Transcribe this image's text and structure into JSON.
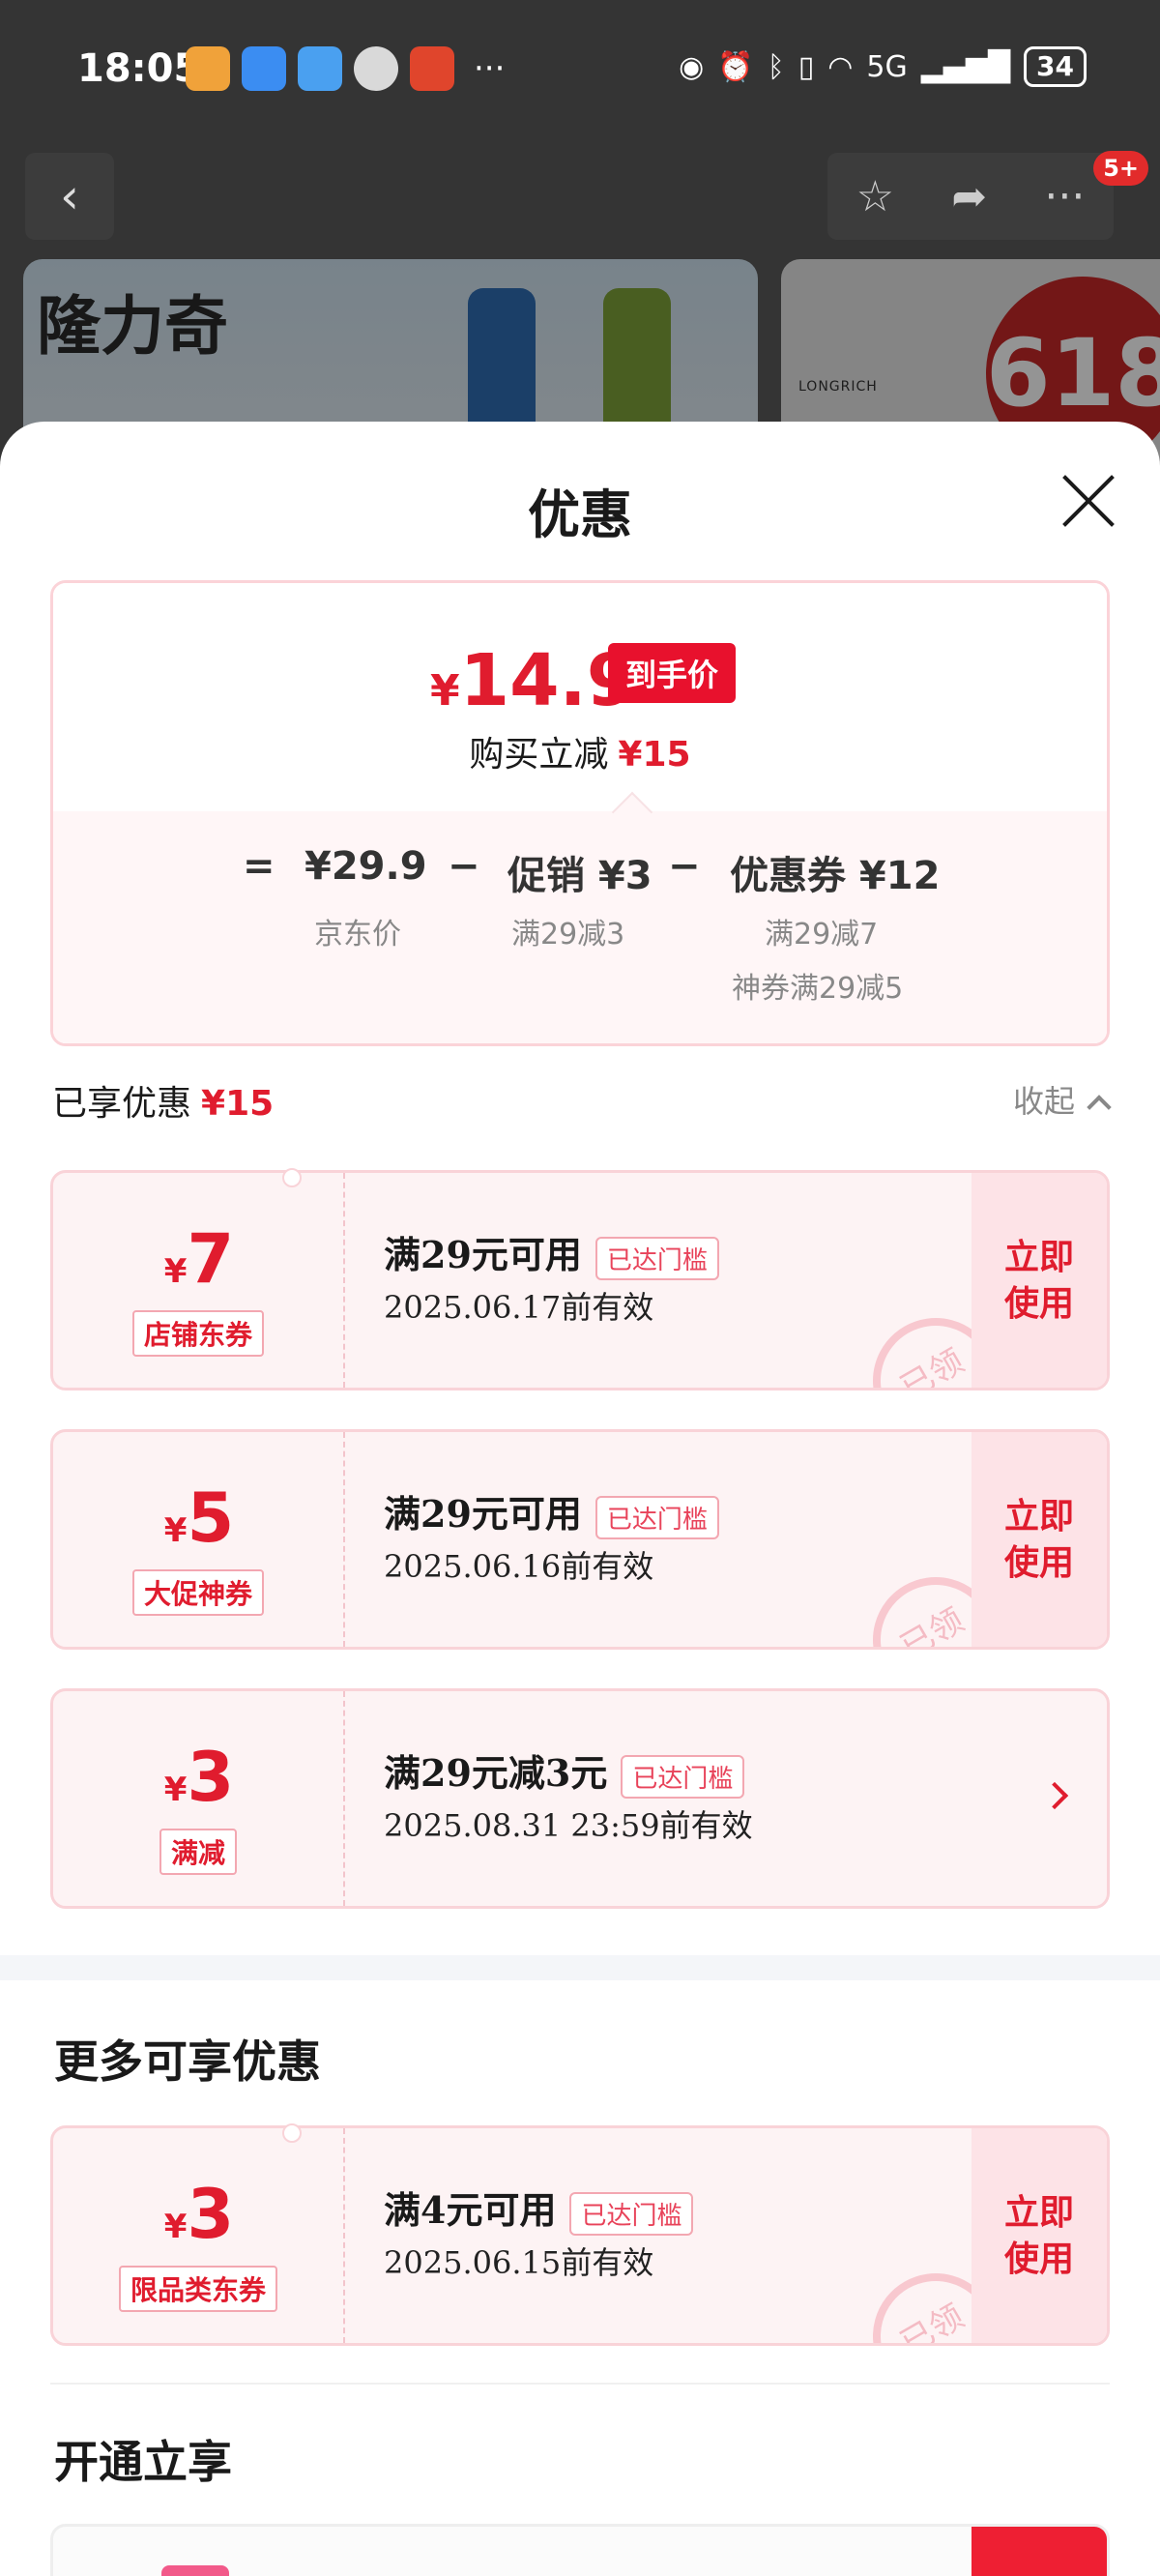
{
  "status_bar": {
    "time": "18:05",
    "network": "5G",
    "battery": "34",
    "more": "···"
  },
  "nav": {
    "badge": "5+"
  },
  "banner": {
    "brand": "隆力奇",
    "logo_text": "LONGRICH",
    "promo": "618"
  },
  "sheet": {
    "title": "优惠"
  },
  "summary": {
    "currency": "¥",
    "final_price": "14.9",
    "final_tag": "到手价",
    "instant_cut_label": "购买立减",
    "instant_cut_value": "¥15",
    "formula": {
      "eq": "=",
      "base": "¥29.9",
      "minus1": "−",
      "promo": "促销 ¥3",
      "minus2": "−",
      "coupon": "优惠券 ¥12"
    },
    "labels": {
      "base": "京东价",
      "promo": "满29减3",
      "coupon_line1": "满29减7",
      "coupon_line2": "神券满29减5"
    }
  },
  "enjoyed": {
    "label": "已享优惠",
    "value": "¥15",
    "collapse": "收起"
  },
  "coupons": [
    {
      "cur": "¥",
      "amount": "7",
      "type": "店铺东券",
      "cond": "满29元可用",
      "tag": "已达门槛",
      "date": "2025.06.17前有效",
      "use1": "立即",
      "use2": "使用",
      "stamp": "已领"
    },
    {
      "cur": "¥",
      "amount": "5",
      "type": "大促神券",
      "cond": "满29元可用",
      "tag": "已达门槛",
      "date": "2025.06.16前有效",
      "use1": "立即",
      "use2": "使用",
      "stamp": "已领"
    },
    {
      "cur": "¥",
      "amount": "3",
      "type": "满减",
      "cond": "满29元减3元",
      "tag": "已达门槛",
      "date": "2025.08.31 23:59前有效"
    }
  ],
  "more": {
    "title": "更多可享优惠",
    "coupon": {
      "cur": "¥",
      "amount": "3",
      "type": "限品类东券",
      "cond": "满4元可用",
      "tag": "已达门槛",
      "date": "2025.06.15前有效",
      "use1": "立即",
      "use2": "使用",
      "stamp": "已领"
    }
  },
  "open": {
    "title": "开通立享"
  },
  "colors": {
    "accent": "#e01c2e",
    "coupon_bg": "#fdf3f4",
    "coupon_border": "#f9d3d8"
  }
}
